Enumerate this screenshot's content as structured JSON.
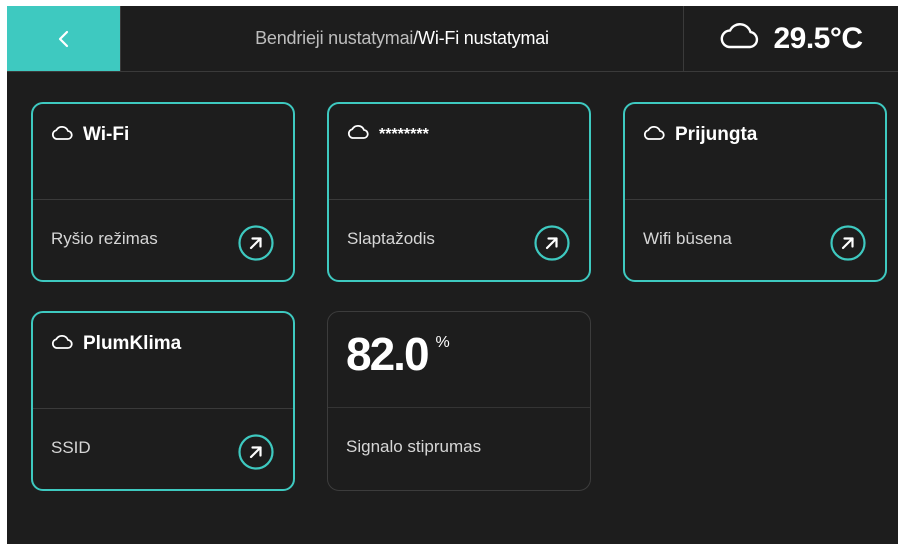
{
  "header": {
    "back_icon": "chevron-left-icon",
    "breadcrumb_parent": "Bendrieji nustatymai",
    "breadcrumb_separator": "/",
    "breadcrumb_current": "Wi-Fi nustatymai",
    "weather_icon": "cloud-icon",
    "temperature": "29.5°C"
  },
  "cards": [
    {
      "value": "Wi-Fi",
      "label": "Ryšio režimas",
      "icon": "cloud-icon",
      "action_icon": "arrow-up-right-icon"
    },
    {
      "value": "********",
      "label": "Slaptažodis",
      "icon": "cloud-icon",
      "action_icon": "arrow-up-right-icon"
    },
    {
      "value": "Prijungta",
      "label": "Wifi būsena",
      "icon": "cloud-icon",
      "action_icon": "arrow-up-right-icon"
    },
    {
      "value": "PlumKlima",
      "label": "SSID",
      "icon": "cloud-icon",
      "action_icon": "arrow-up-right-icon"
    }
  ],
  "signal": {
    "value": "82.0",
    "unit": "%",
    "label": "Signalo stiprumas"
  },
  "colors": {
    "accent": "#3ec9c0",
    "background": "#1d1d1d",
    "text": "#ffffff",
    "muted_text": "#bdbdbd"
  }
}
